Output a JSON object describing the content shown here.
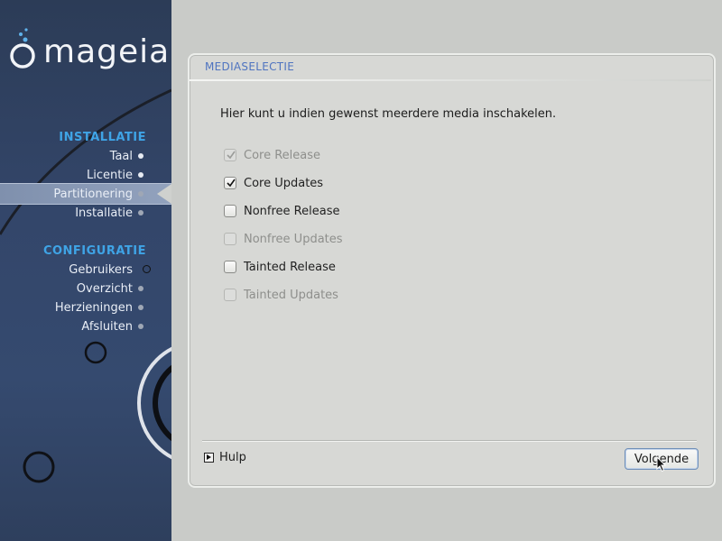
{
  "app": {
    "logo_text": "mageia"
  },
  "sidebar": {
    "sections": [
      {
        "title": "INSTALLATIE",
        "steps": [
          {
            "label": "Taal",
            "state": "done"
          },
          {
            "label": "Licentie",
            "state": "done"
          },
          {
            "label": "Partitionering",
            "state": "active"
          },
          {
            "label": "Installatie",
            "state": "pending"
          }
        ]
      },
      {
        "title": "CONFIGURATIE",
        "steps": [
          {
            "label": "Gebruikers",
            "state": "pending"
          },
          {
            "label": "Overzicht",
            "state": "pending"
          },
          {
            "label": "Herzieningen",
            "state": "pending"
          },
          {
            "label": "Afsluiten",
            "state": "pending"
          }
        ]
      }
    ]
  },
  "dialog": {
    "title": "MEDIASELECTIE",
    "intro": "Hier kunt u indien gewenst meerdere media inschakelen.",
    "options": [
      {
        "label": "Core Release",
        "checked": true,
        "enabled": false
      },
      {
        "label": "Core Updates",
        "checked": true,
        "enabled": true
      },
      {
        "label": "Nonfree Release",
        "checked": false,
        "enabled": true
      },
      {
        "label": "Nonfree Updates",
        "checked": false,
        "enabled": false
      },
      {
        "label": "Tainted Release",
        "checked": false,
        "enabled": true
      },
      {
        "label": "Tainted Updates",
        "checked": false,
        "enabled": false
      }
    ],
    "help_label": "Hulp",
    "next_label": "Volgende"
  },
  "colors": {
    "section_title": "#3fa4e6",
    "dialog_title": "#4f74c0",
    "sidebar_bg": "#33466a",
    "main_bg": "#c9cbc8"
  }
}
